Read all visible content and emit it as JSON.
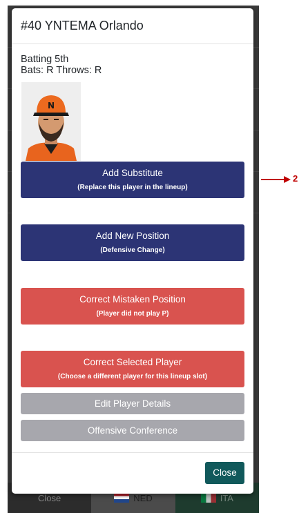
{
  "background_app": {
    "footer": {
      "close_label": "Close",
      "team_home": "NED",
      "team_away": "ITA"
    }
  },
  "modal": {
    "title": "#40 YNTEMA Orlando",
    "batting_order": "Batting 5th",
    "bats_throws": "Bats: R Throws: R",
    "player_photo_alt": "Player photo",
    "buttons": {
      "add_substitute": {
        "label": "Add Substitute",
        "sublabel": "(Replace this player in the lineup)"
      },
      "add_new_position": {
        "label": "Add New Position",
        "sublabel": "(Defensive Change)"
      },
      "correct_mistaken_position": {
        "label": "Correct Mistaken Position",
        "sublabel": "(Player did not play P)"
      },
      "correct_selected_player": {
        "label": "Correct Selected Player",
        "sublabel": "(Choose a different player for this lineup slot)"
      },
      "edit_player_details": {
        "label": "Edit Player Details"
      },
      "offensive_conference": {
        "label": "Offensive Conference"
      }
    },
    "close_label": "Close"
  },
  "annotation": {
    "label": "2"
  },
  "colors": {
    "navy": "#2c3475",
    "red": "#d9534f",
    "gray": "#a7a7ad",
    "teal": "#11595b",
    "annotation": "#c00000"
  }
}
